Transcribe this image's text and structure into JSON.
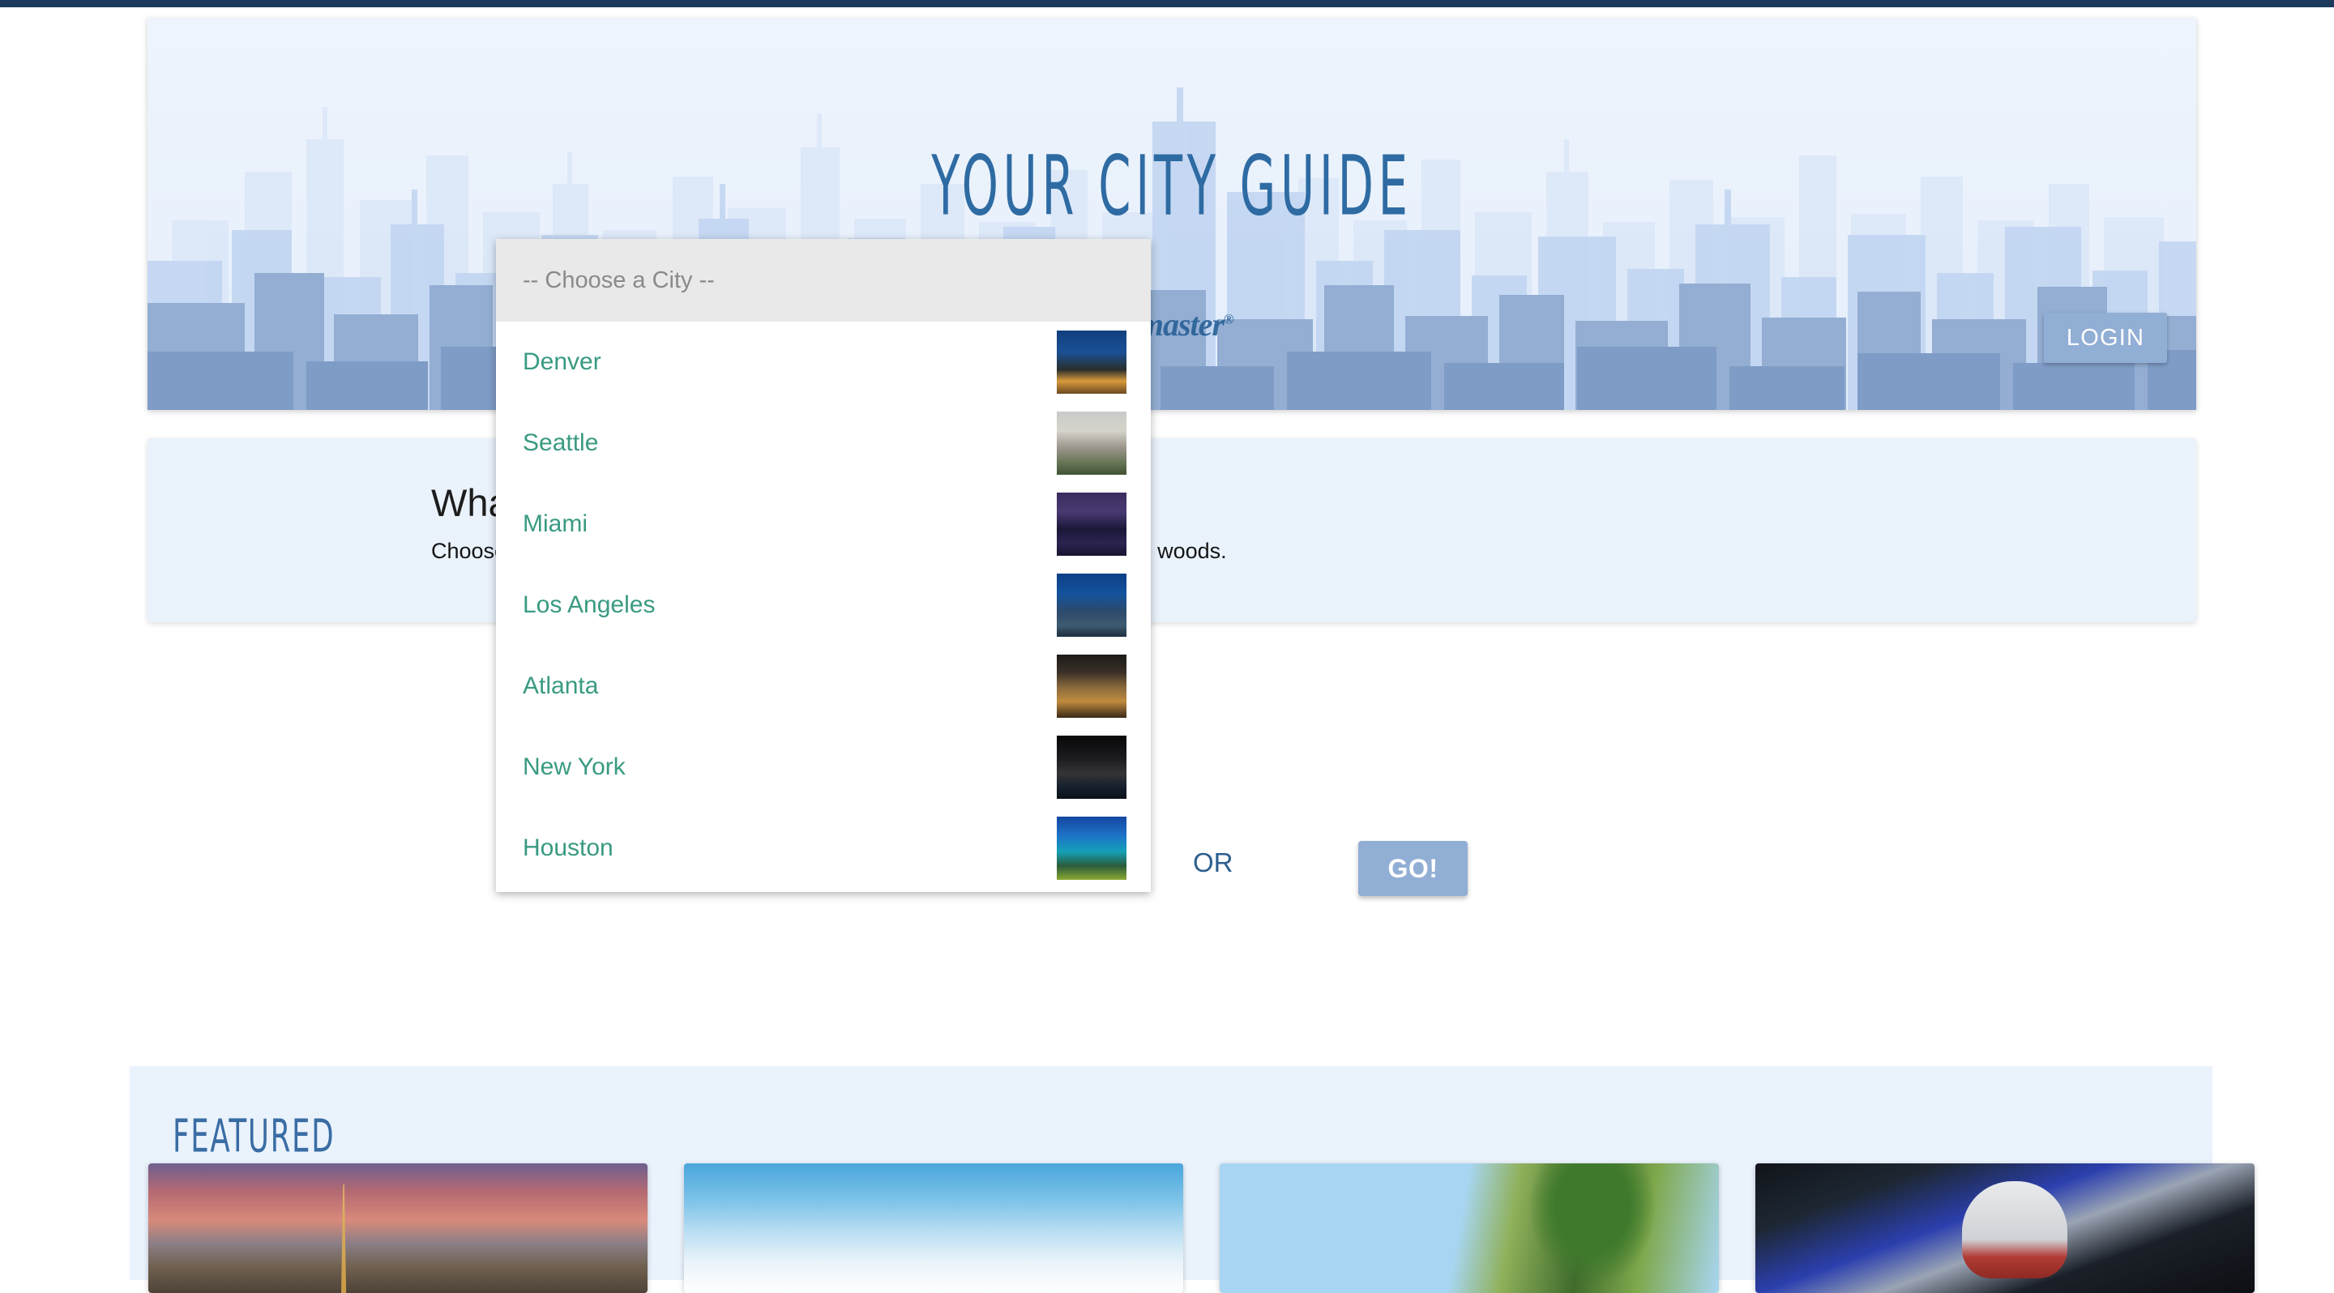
{
  "topbar": {
    "color": "#1b3a5c"
  },
  "hero": {
    "title": "YOUR CITY GUIDE",
    "brand_logo": "ticketmaster",
    "brand_mark": "®",
    "login_label": "LOGIN",
    "bg_color": "#e9f1fc",
    "title_color": "#2e6ba3"
  },
  "info_panel": {
    "heading": "What's Happening in Town?",
    "body": "Choose a city, or click GO! to find out what's happening in your neck of the woods.",
    "bg_color": "#eaf2fc"
  },
  "search": {
    "or_label": "OR",
    "go_label": "GO!",
    "go_color": "#91aed5"
  },
  "dropdown": {
    "placeholder": "-- Choose a City --",
    "open": true,
    "option_color": "#399a82",
    "options": [
      {
        "label": "Denver",
        "thumb": "denver-skyline-thumb",
        "thumb_class": "t-denver"
      },
      {
        "label": "Seattle",
        "thumb": "seattle-skyline-thumb",
        "thumb_class": "t-seattle"
      },
      {
        "label": "Miami",
        "thumb": "miami-skyline-thumb",
        "thumb_class": "t-miami"
      },
      {
        "label": "Los Angeles",
        "thumb": "los-angeles-skyline-thumb",
        "thumb_class": "t-la"
      },
      {
        "label": "Atlanta",
        "thumb": "atlanta-skyline-thumb",
        "thumb_class": "t-atl"
      },
      {
        "label": "New York",
        "thumb": "new-york-skyline-thumb",
        "thumb_class": "t-ny"
      },
      {
        "label": "Houston",
        "thumb": "houston-skyline-thumb",
        "thumb_class": "t-hou"
      }
    ]
  },
  "featured": {
    "title": "FEATURED",
    "title_color": "#3a6da4",
    "cards": [
      {
        "image": "las-vegas-strip-sunset-image",
        "image_class": "c-vegas"
      },
      {
        "image": "skier-snow-mountain-image",
        "image_class": "c-ski"
      },
      {
        "image": "palm-trees-blue-sky-image",
        "image_class": "c-palm"
      },
      {
        "image": "patriots-football-player-image",
        "image_class": "c-nfl"
      }
    ]
  }
}
